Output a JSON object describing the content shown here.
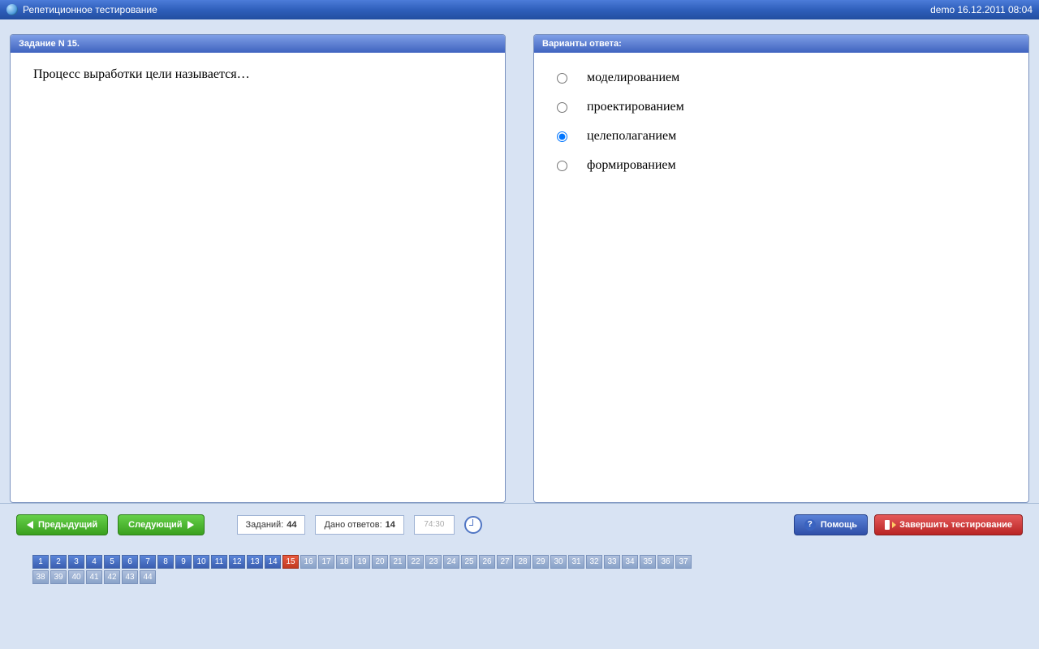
{
  "topbar": {
    "title": "Репетиционное тестирование",
    "right": "demo 16.12.2011 08:04"
  },
  "question_panel": {
    "header": "Задание N 15.",
    "text": "Процесс выработки цели называется…"
  },
  "answers_panel": {
    "header": "Варианты ответа:",
    "options": [
      {
        "label": "моделированием",
        "selected": false
      },
      {
        "label": "проектированием",
        "selected": false
      },
      {
        "label": "целеполаганием",
        "selected": true
      },
      {
        "label": "формированием",
        "selected": false
      }
    ]
  },
  "toolbar": {
    "prev": "Предыдущий",
    "next": "Следующий",
    "tasks_label": "Заданий:",
    "tasks_value": "44",
    "answered_label": "Дано ответов:",
    "answered_value": "14",
    "time": "74:30",
    "help": "Помощь",
    "finish": "Завершить тестирование"
  },
  "pager": {
    "total": 44,
    "current": 15,
    "answered": [
      1,
      2,
      3,
      4,
      5,
      6,
      7,
      8,
      9,
      10,
      11,
      12,
      13,
      14
    ]
  }
}
